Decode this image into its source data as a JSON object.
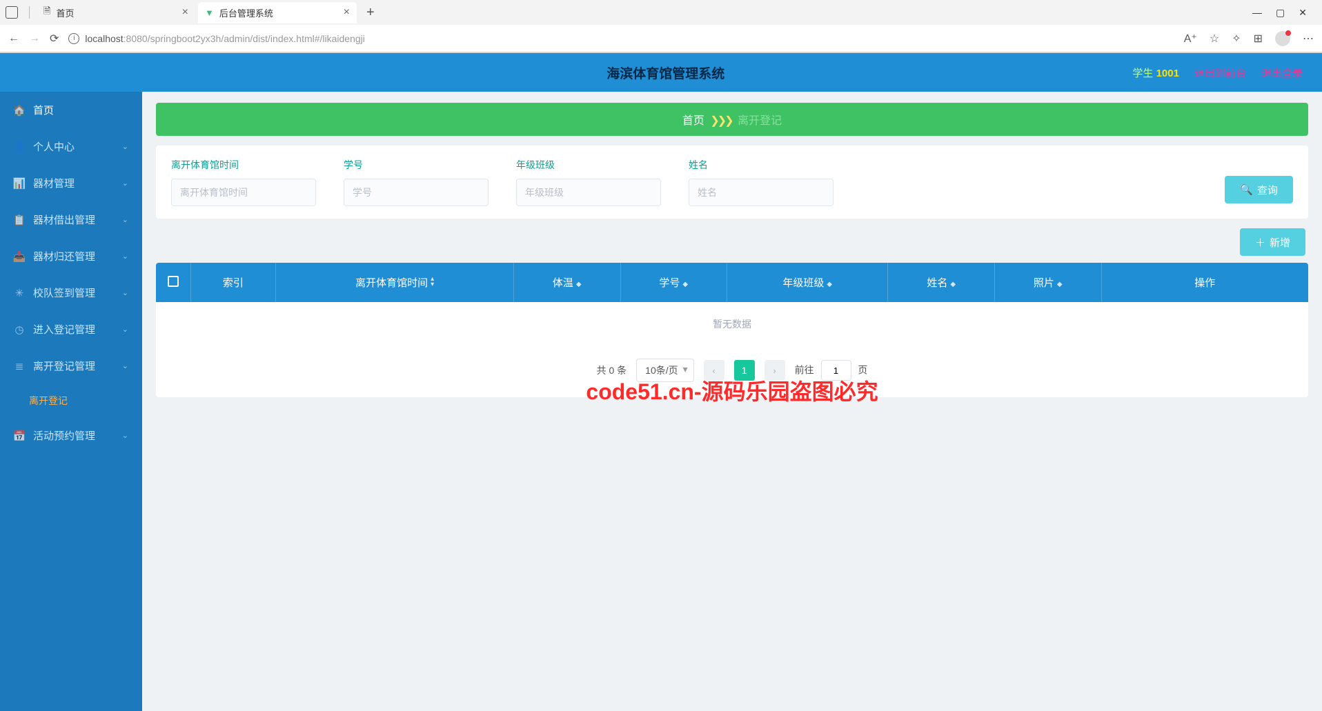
{
  "browser": {
    "tabs": [
      {
        "title": "首页",
        "icon": "doc"
      },
      {
        "title": "后台管理系统",
        "icon": "vue"
      }
    ],
    "url_host": "localhost",
    "url_port_path": ":8080/springboot2yx3h/admin/dist/index.html#/likaidengji",
    "window_min": "—",
    "window_max": "▢",
    "window_close": "✕"
  },
  "header": {
    "title": "海滨体育馆管理系统",
    "user_role": "学生",
    "user_id": "1001",
    "link_front": "退出到前台",
    "link_logout": "退出登录"
  },
  "sidebar": {
    "items": [
      {
        "label": "首页",
        "icon": "🏠"
      },
      {
        "label": "个人中心",
        "icon": "👤",
        "expandable": true
      },
      {
        "label": "器材管理",
        "icon": "📊",
        "expandable": true
      },
      {
        "label": "器材借出管理",
        "icon": "📋",
        "expandable": true
      },
      {
        "label": "器材归还管理",
        "icon": "📥",
        "expandable": true
      },
      {
        "label": "校队签到管理",
        "icon": "✳",
        "expandable": true
      },
      {
        "label": "进入登记管理",
        "icon": "◷",
        "expandable": true
      },
      {
        "label": "离开登记管理",
        "icon": "≣",
        "expandable": true
      },
      {
        "label": "活动预约管理",
        "icon": "📅",
        "expandable": true
      }
    ],
    "submenu_leave": "离开登记"
  },
  "breadcrumb": {
    "home": "首页",
    "arrows": "❯❯❯",
    "current": "离开登记"
  },
  "search": {
    "f1_label": "离开体育馆时间",
    "f1_ph": "离开体育馆时间",
    "f2_label": "学号",
    "f2_ph": "学号",
    "f3_label": "年级班级",
    "f3_ph": "年级班级",
    "f4_label": "姓名",
    "f4_ph": "姓名",
    "btn_query": "查询"
  },
  "actions": {
    "add": "新增"
  },
  "table": {
    "cols": [
      "",
      "索引",
      "离开体育馆时间",
      "体温",
      "学号",
      "年级班级",
      "姓名",
      "照片",
      "操作"
    ],
    "empty": "暂无数据"
  },
  "pagination": {
    "total_text": "共 0 条",
    "per_page": "10条/页",
    "current": "1",
    "goto_label": "前往",
    "goto_value": "1",
    "goto_suffix": "页"
  },
  "watermark": "code51.cn-源码乐园盗图必究"
}
